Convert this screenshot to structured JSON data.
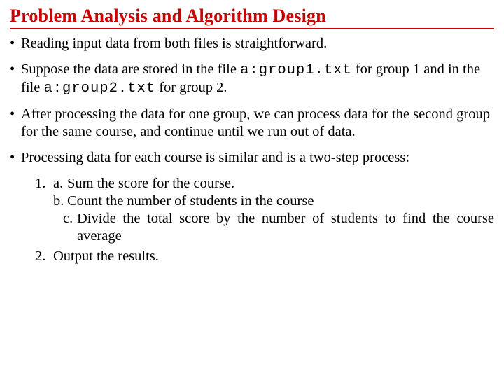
{
  "title": "Problem Analysis and Algorithm Design",
  "bullets": {
    "b1": "Reading input data from both files is straightforward.",
    "b2_pre": "Suppose the data are stored in the file ",
    "b2_file1": "a:group1.txt",
    "b2_mid": " for group 1 and in the file ",
    "b2_file2": "a:group2.txt",
    "b2_post": " for group 2.",
    "b3": "After processing the data for one group, we can process data for the second group for the same course, and continue until we run out of data.",
    "b4": "Processing data for each course is similar and is a two-step process:"
  },
  "numlist": {
    "n1": "1.",
    "n1a_letter": "a.",
    "n1a_text": "Sum the score for the course.",
    "n1b_letter": "b.",
    "n1b_text": "Count the number of students in the course",
    "n1c_letter": "c.",
    "n1c_text": "Divide the total score by the number of students to find the course average",
    "n2": "2.",
    "n2_text": "Output the results."
  }
}
